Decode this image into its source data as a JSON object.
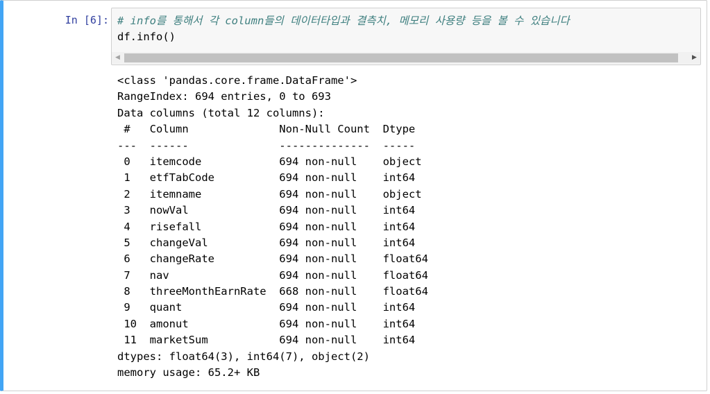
{
  "prompt": "In [6]:",
  "input": {
    "comment": "# info를 통해서 각 column들의 데이터타입과 결측치, 메모리 사용량 등을 볼 수 있습니다",
    "code": "df.info()"
  },
  "scrollbar": {
    "left_arrow": "◀",
    "right_arrow": "▶"
  },
  "output": {
    "lines": [
      "<class 'pandas.core.frame.DataFrame'>",
      "RangeIndex: 694 entries, 0 to 693",
      "Data columns (total 12 columns):",
      " #   Column              Non-Null Count  Dtype  ",
      "---  ------              --------------  -----  ",
      " 0   itemcode            694 non-null    object ",
      " 1   etfTabCode          694 non-null    int64  ",
      " 2   itemname            694 non-null    object ",
      " 3   nowVal              694 non-null    int64  ",
      " 4   risefall            694 non-null    int64  ",
      " 5   changeVal           694 non-null    int64  ",
      " 6   changeRate          694 non-null    float64",
      " 7   nav                 694 non-null    float64",
      " 8   threeMonthEarnRate  668 non-null    float64",
      " 9   quant               694 non-null    int64  ",
      " 10  amonut              694 non-null    int64  ",
      " 11  marketSum           694 non-null    int64  ",
      "dtypes: float64(3), int64(7), object(2)",
      "memory usage: 65.2+ KB"
    ]
  }
}
